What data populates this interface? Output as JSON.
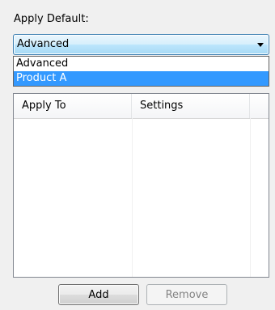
{
  "apply_default_label": "Apply Default:",
  "combo": {
    "selected_value": "Advanced"
  },
  "dropdown": {
    "options": [
      {
        "label": "Advanced",
        "selected": false
      },
      {
        "label": "Product A",
        "selected": true
      }
    ]
  },
  "table": {
    "columns": [
      "Apply To",
      "Settings",
      ""
    ],
    "rows": []
  },
  "buttons": {
    "add": "Add",
    "remove": "Remove"
  },
  "colors": {
    "selection": "#3399ff",
    "combo_border": "#3c7fb1",
    "disabled_text": "#838383"
  }
}
